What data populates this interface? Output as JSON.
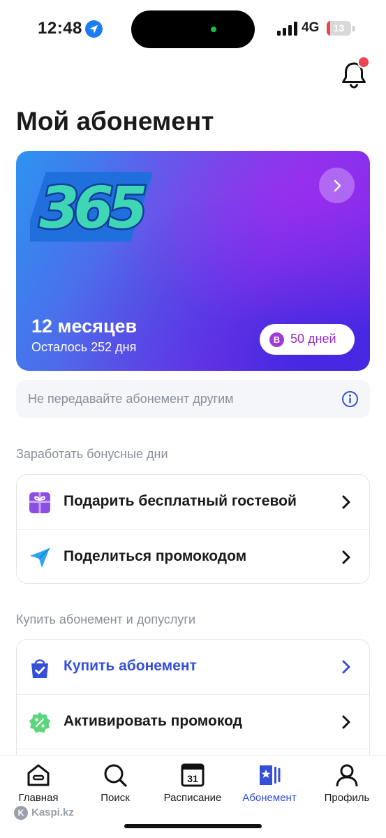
{
  "status_bar": {
    "time": "12:48",
    "network": "4G",
    "battery_percent": 13,
    "battery_label": "13",
    "location_icon": "location-arrow-icon",
    "signal_icon": "cellular-signal-icon"
  },
  "header": {
    "title": "Мой абонемент",
    "bell_icon": "bell-icon",
    "has_notification": true
  },
  "subscription_card": {
    "logo_text": "365",
    "period": "12 месяцев",
    "remaining": "Осталось 252 дня",
    "bonus_badge": "B",
    "bonus_label": "50 дней",
    "arrow_icon": "chevron-right-icon"
  },
  "notice": {
    "text": "Не передавайте абонемент другим",
    "icon": "info-icon"
  },
  "bonus_section": {
    "title": "Заработать бонусные дни",
    "items": [
      {
        "label": "Подарить бесплатный гостевой",
        "icon": "gift-icon"
      },
      {
        "label": "Поделиться промокодом",
        "icon": "paper-plane-icon"
      }
    ]
  },
  "buy_section": {
    "title": "Купить абонемент и допуслуги",
    "items": [
      {
        "label": "Купить абонемент",
        "icon": "shopping-bag-icon"
      },
      {
        "label": "Активировать промокод",
        "icon": "promo-badge-icon"
      }
    ]
  },
  "tab_bar": {
    "tabs": [
      {
        "label": "Главная",
        "icon": "home-icon"
      },
      {
        "label": "Поиск",
        "icon": "search-icon"
      },
      {
        "label": "Расписание",
        "icon": "calendar-icon",
        "calendar_day": "31"
      },
      {
        "label": "Абонемент",
        "icon": "membership-card-icon",
        "active": true
      },
      {
        "label": "Профиль",
        "icon": "profile-icon"
      }
    ]
  },
  "watermark": {
    "logo": "K",
    "text": "Kaspi.kz"
  },
  "colors": {
    "accent": "#3550d8",
    "notification_dot": "#ef4452",
    "bonus": "#9a2fcf",
    "card_gradient_start": "#2d93f2",
    "card_gradient_end": "#5a2ce6"
  }
}
